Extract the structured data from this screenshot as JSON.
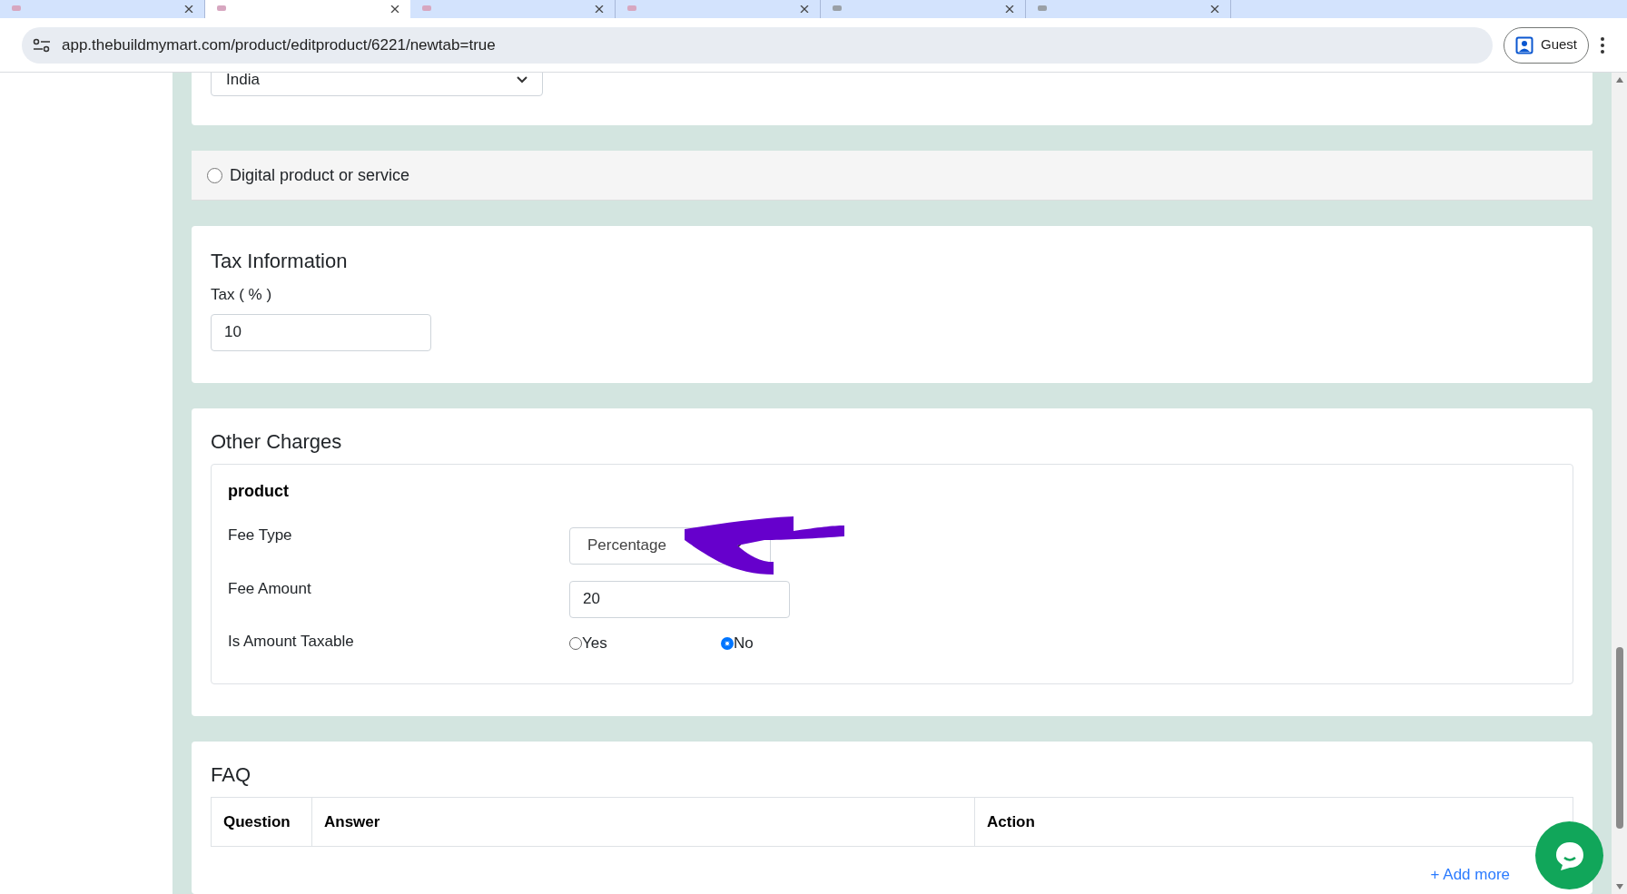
{
  "browser": {
    "tabs": [
      {
        "selected": false,
        "color": "#d7a7c0"
      },
      {
        "selected": true,
        "color": "#d7a7c0"
      },
      {
        "selected": false,
        "color": "#d7a7c0"
      },
      {
        "selected": false,
        "color": "#d7a7c0"
      },
      {
        "selected": false,
        "color": "#9aa0a6"
      },
      {
        "selected": false,
        "color": "#9aa0a6"
      }
    ],
    "url": "app.thebuildmymart.com/product/editproduct/6221/newtab=true",
    "profile": "Guest"
  },
  "country_select": {
    "value": "India"
  },
  "digital_option": {
    "label": "Digital product or service",
    "selected": false
  },
  "tax": {
    "title": "Tax Information",
    "label": "Tax ( % )",
    "value": "10"
  },
  "other_charges": {
    "title": "Other Charges",
    "group": "product",
    "fee_type": {
      "label": "Fee Type",
      "value": "Percentage"
    },
    "fee_amount": {
      "label": "Fee Amount",
      "value": "20"
    },
    "taxable": {
      "label": "Is Amount Taxable",
      "options": [
        {
          "label": "Yes",
          "selected": false
        },
        {
          "label": "No",
          "selected": true
        }
      ]
    }
  },
  "faq": {
    "title": "FAQ",
    "columns": [
      "Question",
      "Answer",
      "Action"
    ],
    "add_link": "+ Add more"
  }
}
